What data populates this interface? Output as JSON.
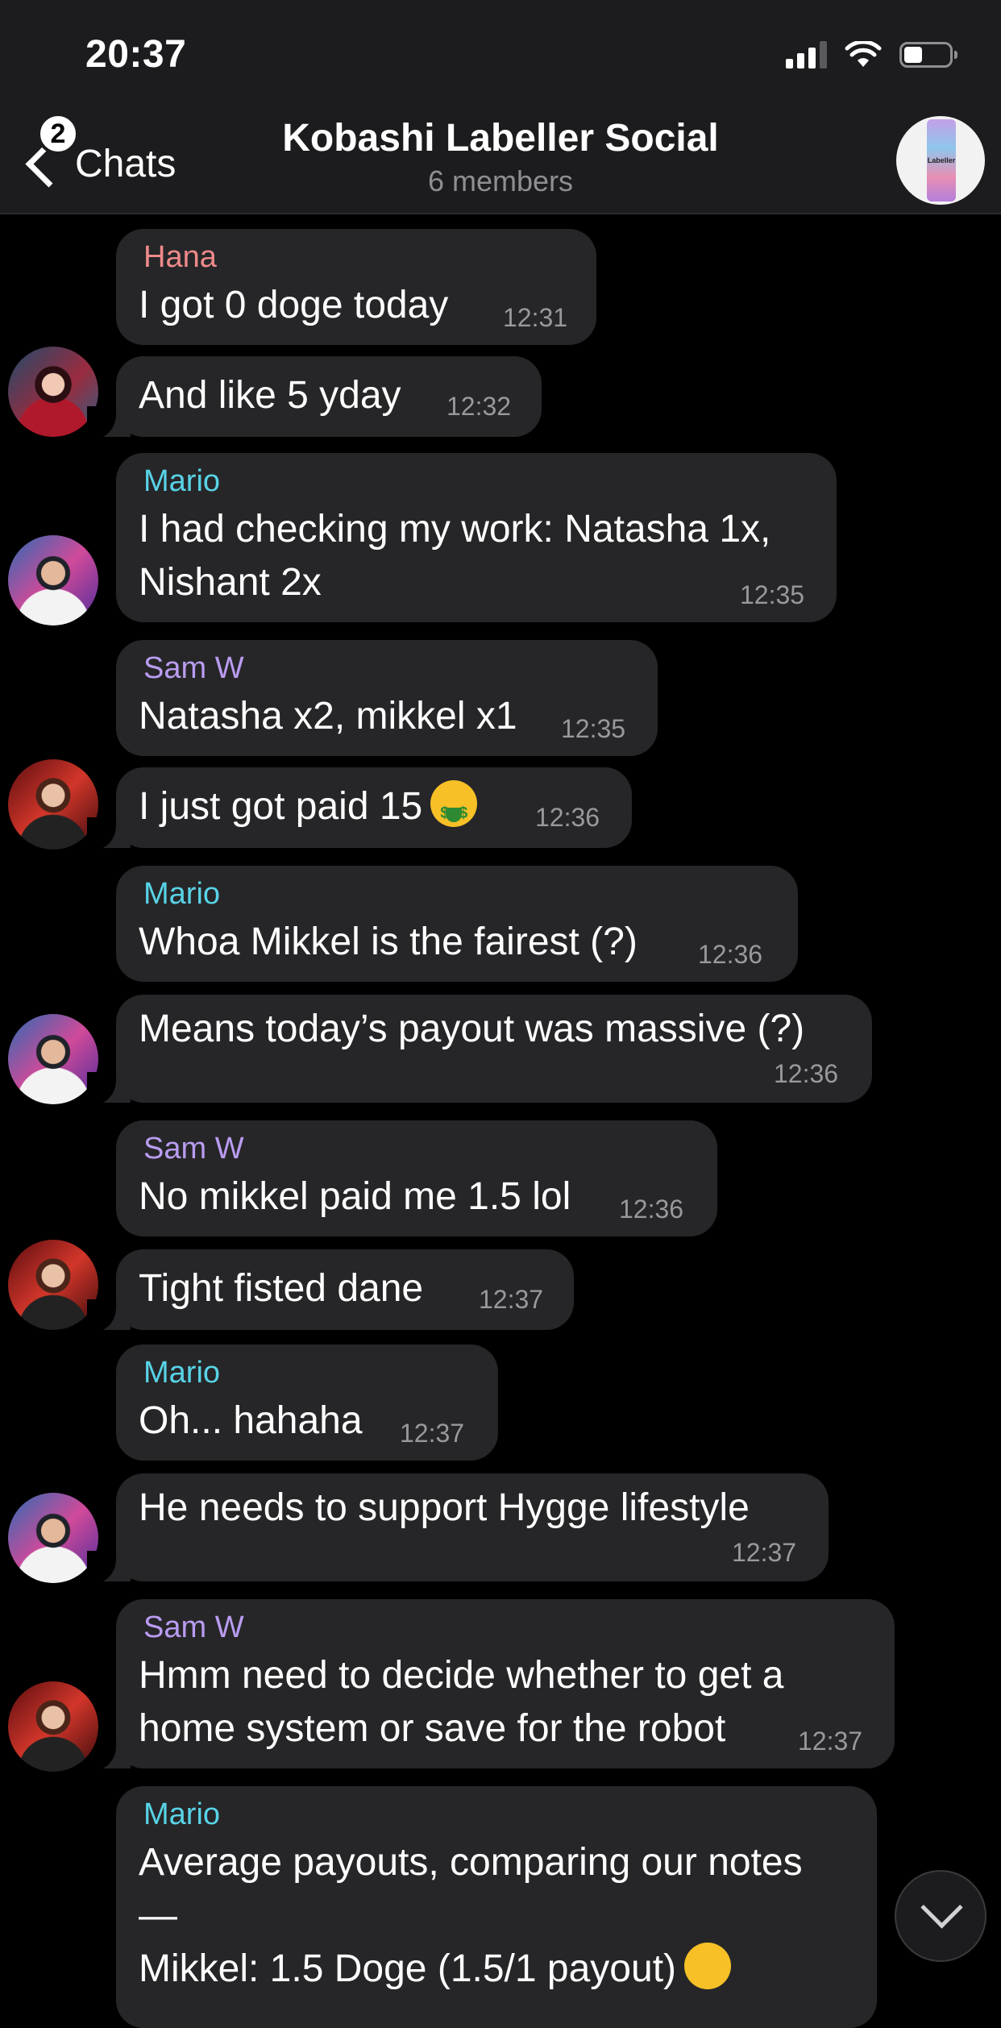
{
  "status_bar": {
    "time": "20:37"
  },
  "nav": {
    "back_label": "Chats",
    "unread_badge": "2",
    "title": "Kobashi Labeller Social",
    "subtitle": "6 members",
    "group_avatar_text": "Labeller"
  },
  "messages": [
    {
      "sender": "Hana",
      "text": "I got 0 doge today",
      "time": "12:31"
    },
    {
      "text": "And like 5 yday",
      "time": "12:32"
    },
    {
      "sender": "Mario",
      "lines": [
        "I had checking my work: Natasha 1x,",
        "Nishant 2x"
      ],
      "time": "12:35"
    },
    {
      "sender": "Sam W",
      "text": "Natasha x2, mikkel x1",
      "time": "12:35"
    },
    {
      "text": "I just got paid 15",
      "time": "12:36"
    },
    {
      "sender": "Mario",
      "text": "Whoa Mikkel is the fairest (?)",
      "time": "12:36"
    },
    {
      "text": "Means today’s payout was massive (?)",
      "time": "12:36"
    },
    {
      "sender": "Sam W",
      "text": "No mikkel paid me 1.5 lol",
      "time": "12:36"
    },
    {
      "text": "Tight fisted dane",
      "time": "12:37"
    },
    {
      "sender": "Mario",
      "text": "Oh... hahaha",
      "time": "12:37"
    },
    {
      "text": "He needs to support Hygge lifestyle",
      "time": "12:37"
    },
    {
      "sender": "Sam W",
      "lines": [
        "Hmm need to decide whether to get a",
        "home system or save for the robot"
      ],
      "time": "12:37"
    },
    {
      "sender": "Mario",
      "lines": [
        "Average payouts, comparing our notes",
        "—",
        "Mikkel: 1.5 Doge (1.5/1 payout)"
      ]
    }
  ]
}
